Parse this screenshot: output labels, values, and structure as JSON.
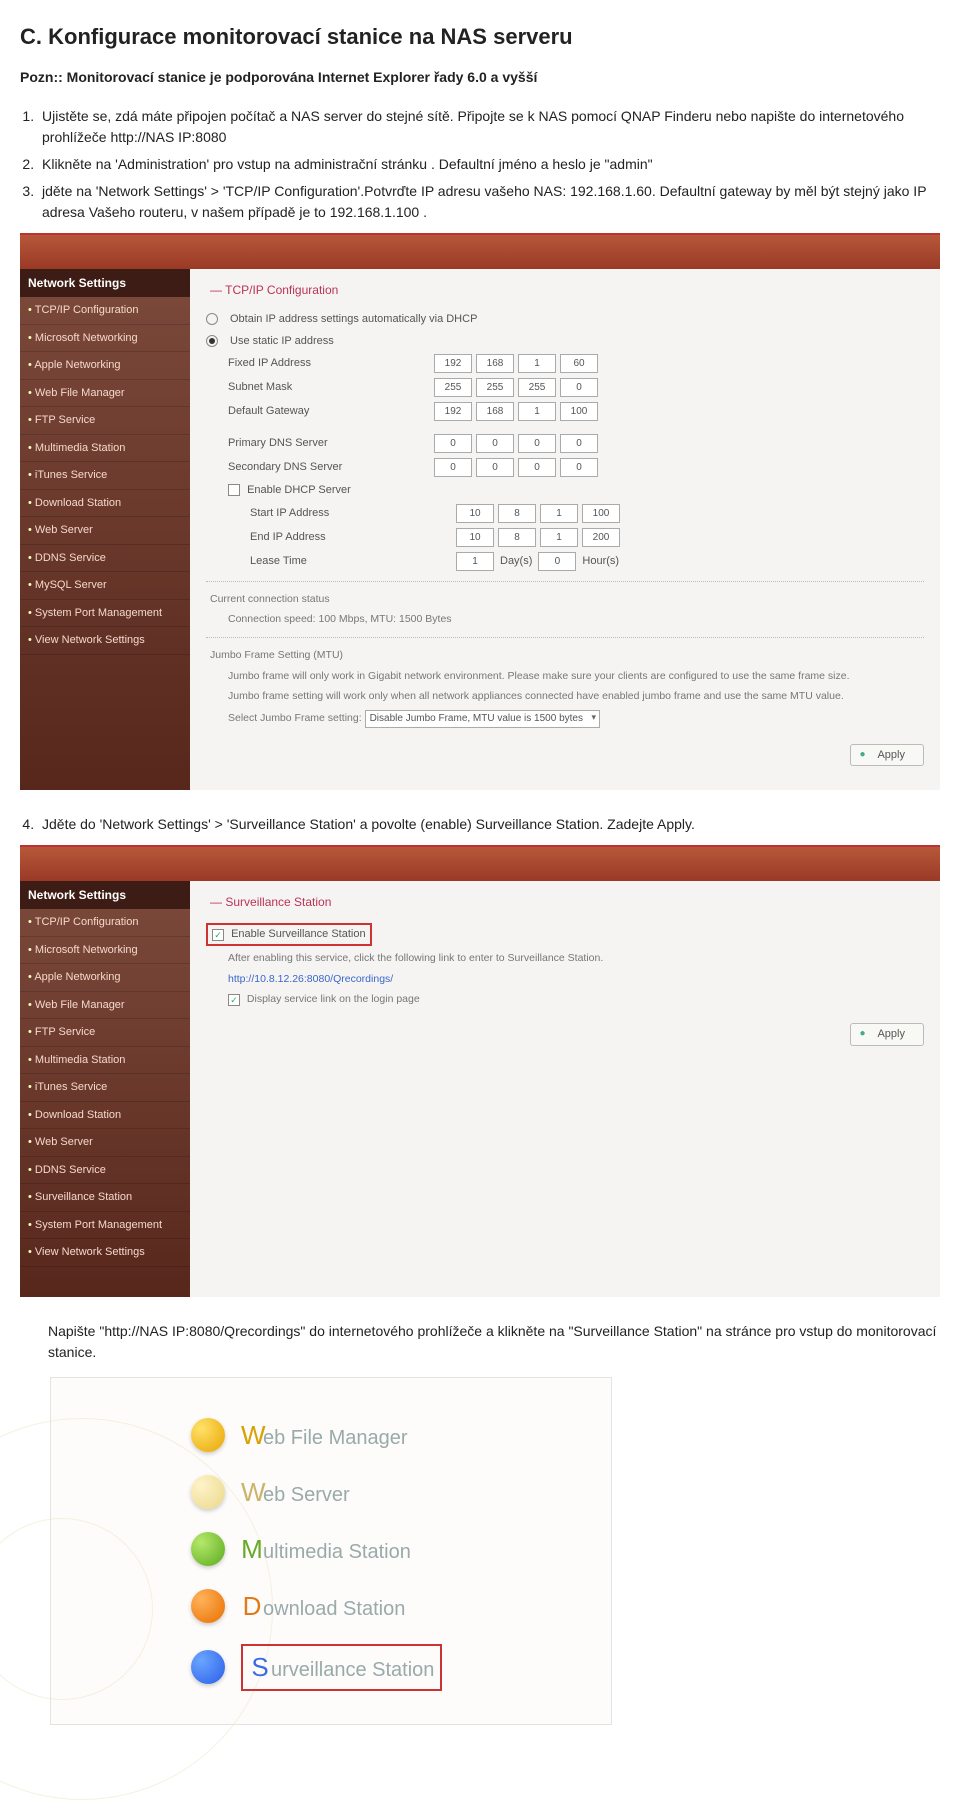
{
  "heading": "C. Konfigurace monitorovací stanice na NAS serveru",
  "note": "Pozn:: Monitorovací stanice je podporována Internet Explorer řady 6.0 a vyšší",
  "list1": {
    "i1": "Ujistěte se, zdá máte připojen počítač a NAS server do stejné sítě. Připojte se k NAS pomocí QNAP Finderu nebo napište do internetového prohlížeče  http://NAS IP:8080",
    "i2": "Klikněte na 'Administration' pro vstup na administrační stránku . Defaultní jméno a heslo je \"admin\"",
    "i3": " jděte na  'Network Settings' > 'TCP/IP Configuration'.Potvrďte IP adresu  vašeho NAS: 192.168.1.60. Defaultní gateway by měl být stejný jako IP adresa Vašeho routeru, v našem případě je to 192.168.1.100 ."
  },
  "panel1": {
    "sectionTitle": "Network Settings",
    "sidebar": {
      "s1": "TCP/IP Configuration",
      "s2": "Microsoft Networking",
      "s3": "Apple Networking",
      "s4": "Web File Manager",
      "s5": "FTP Service",
      "s6": "Multimedia Station",
      "s7": "iTunes Service",
      "s8": "Download Station",
      "s9": "Web Server",
      "s10": "DDNS Service",
      "s11": "MySQL Server",
      "s12": "System Port Management",
      "s13": "View Network Settings"
    },
    "main": {
      "title": "TCP/IP Configuration",
      "r1": "Obtain IP address settings automatically via DHCP",
      "r2": "Use static IP address",
      "f_fixed": "Fixed IP Address",
      "f_mask": "Subnet Mask",
      "f_gw": "Default Gateway",
      "ip_fixed": [
        "192",
        "168",
        "1",
        "60"
      ],
      "ip_mask": [
        "255",
        "255",
        "255",
        "0"
      ],
      "ip_gw": [
        "192",
        "168",
        "1",
        "100"
      ],
      "f_pdns": "Primary DNS Server",
      "f_sdns": "Secondary DNS Server",
      "ip_pdns": [
        "0",
        "0",
        "0",
        "0"
      ],
      "ip_sdns": [
        "0",
        "0",
        "0",
        "0"
      ],
      "cb_dhcp": "Enable DHCP Server",
      "f_sip": "Start IP Address",
      "f_eip": "End IP Address",
      "f_lease": "Lease Time",
      "ip_sip": [
        "10",
        "8",
        "1",
        "100"
      ],
      "ip_eip": [
        "10",
        "8",
        "1",
        "200"
      ],
      "lease_d": "1",
      "lease_d_unit": "Day(s)",
      "lease_h": "0",
      "lease_h_unit": "Hour(s)",
      "conn_label": "Current connection status",
      "conn_value": "Connection speed: 100 Mbps, MTU: 1500 Bytes",
      "jumbo_title": "Jumbo Frame Setting (MTU)",
      "jumbo_p1": "Jumbo frame will only work in Gigabit network environment. Please make sure your clients are configured to use the same frame size.",
      "jumbo_p2": "Jumbo frame setting will work only when all network appliances connected have enabled jumbo frame and use the same MTU value.",
      "jumbo_select_label": "Select Jumbo Frame setting:",
      "jumbo_select_value": "Disable Jumbo Frame, MTU value is 1500 bytes",
      "apply": "Apply"
    }
  },
  "item4": "Jděte do  'Network Settings' > 'Surveillance Station'  a povolte (enable)  Surveillance Station. Zadejte Apply.",
  "panel2": {
    "sectionTitle": "Network Settings",
    "sidebar": {
      "s1": "TCP/IP Configuration",
      "s2": "Microsoft Networking",
      "s3": "Apple Networking",
      "s4": "Web File Manager",
      "s5": "FTP Service",
      "s6": "Multimedia Station",
      "s7": "iTunes Service",
      "s8": "Download Station",
      "s9": "Web Server",
      "s10": "DDNS Service",
      "s11": "Surveillance Station",
      "s12": "System Port Management",
      "s13": "View Network Settings"
    },
    "main": {
      "title": "Surveillance Station",
      "cb_enable": "Enable Surveillance Station",
      "after": "After enabling this service, click the following link to enter to Surveillance Station.",
      "link": "http://10.8.12.26:8080/Qrecordings/",
      "cb_display": "Display service link on the login page",
      "apply": "Apply"
    }
  },
  "para_after": "Napište \"http://NAS IP:8080/Qrecordings\" do internetového prohlížeče a klikněte na \"Surveillance Station\" na stránce pro vstup do monitorovací stanice.",
  "stations": {
    "s1": {
      "first": "W",
      "rest": "eb File Manager",
      "color": "#e8a400"
    },
    "s2": {
      "first": "W",
      "rest": "eb Server"
    },
    "s3": {
      "first": "M",
      "rest": "ultimedia Station"
    },
    "s4": {
      "first": "D",
      "rest": "ownload Station"
    },
    "s5": {
      "first": "S",
      "rest": "urveillance Station"
    }
  }
}
